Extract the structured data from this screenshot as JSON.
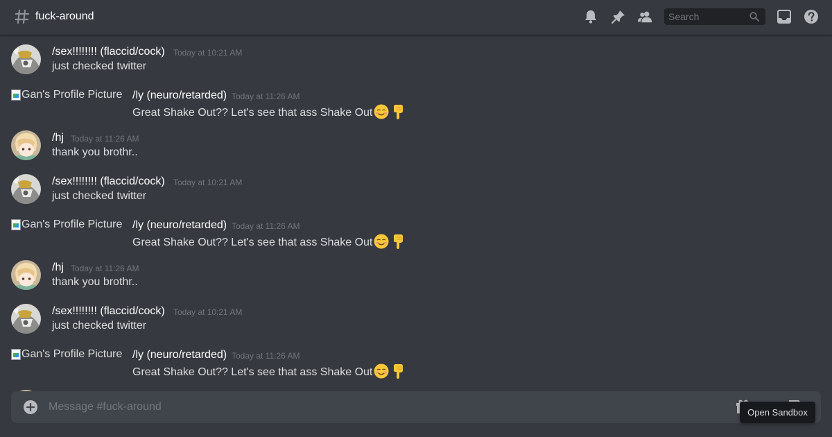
{
  "header": {
    "channel_name": "fuck-around",
    "search_placeholder": "Search"
  },
  "icons": {
    "channel": "hash-icon",
    "notifications": "bell-icon",
    "pins": "pin-icon",
    "members": "members-icon",
    "search": "search-icon",
    "inbox": "inbox-icon",
    "help": "help-icon",
    "attach": "plus-circle-icon",
    "gift": "gift-icon",
    "gif": "gif-icon",
    "sticker": "sticker-icon"
  },
  "messages": [
    {
      "kind": "avatar-crest",
      "username": "/sex!!!!!!!! (flaccid/cock)",
      "timestamp": "Today at 10:21 AM",
      "content": "just checked twitter"
    },
    {
      "kind": "broken-image",
      "avatar_alt": "Gan's Profile Picture",
      "username": "/ly (neuro/retarded)",
      "timestamp": "Today at 11:26 AM",
      "content": "Great Shake Out?? Let's see that ass Shake Out",
      "emoji": [
        "relieved-face-emoji",
        "pointing-down-emoji"
      ]
    },
    {
      "kind": "avatar-anime",
      "username": "/hj",
      "timestamp": "Today at 11:26 AM",
      "content": "thank you brothr.."
    },
    {
      "kind": "avatar-crest",
      "username": "/sex!!!!!!!! (flaccid/cock)",
      "timestamp": "Today at 10:21 AM",
      "content": "just checked twitter"
    },
    {
      "kind": "broken-image",
      "avatar_alt": "Gan's Profile Picture",
      "username": "/ly (neuro/retarded)",
      "timestamp": "Today at 11:26 AM",
      "content": "Great Shake Out?? Let's see that ass Shake Out",
      "emoji": [
        "relieved-face-emoji",
        "pointing-down-emoji"
      ]
    },
    {
      "kind": "avatar-anime",
      "username": "/hj",
      "timestamp": "Today at 11:26 AM",
      "content": "thank you brothr.."
    },
    {
      "kind": "avatar-crest",
      "username": "/sex!!!!!!!! (flaccid/cock)",
      "timestamp": "Today at 10:21 AM",
      "content": "just checked twitter"
    },
    {
      "kind": "broken-image",
      "avatar_alt": "Gan's Profile Picture",
      "username": "/ly (neuro/retarded)",
      "timestamp": "Today at 11:26 AM",
      "content": "Great Shake Out?? Let's see that ass Shake Out",
      "emoji": [
        "relieved-face-emoji",
        "pointing-down-emoji"
      ]
    }
  ],
  "composer": {
    "placeholder": "Message #fuck-around"
  },
  "tooltip": {
    "text": "Open Sandbox"
  },
  "colors": {
    "background": "#36393f",
    "composer": "#40444b",
    "username": "#ffffff",
    "timestamp": "#72767d",
    "tooltip": "#18191c"
  }
}
